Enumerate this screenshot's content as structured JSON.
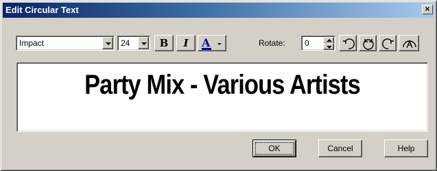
{
  "window": {
    "title": "Edit Circular Text",
    "close_glyph": "×"
  },
  "toolbar": {
    "font_name": "Impact",
    "font_size": "24",
    "bold_label": "B",
    "italic_label": "I",
    "color_label": "A",
    "rotate_label": "Rotate:",
    "rotate_value": "0"
  },
  "icons": {
    "font_dropdown": "chevron-down-icon",
    "size_dropdown": "chevron-down-icon",
    "rotate_ccw": "rotate-counterclockwise-icon",
    "rotate_both": "rotate-both-icon",
    "rotate_cw": "rotate-clockwise-icon",
    "text_on_arc": "text-on-arc-icon"
  },
  "preview": {
    "text": "Party Mix - Various Artists"
  },
  "buttons": {
    "ok": "OK",
    "cancel": "Cancel",
    "help": "Help"
  },
  "colors": {
    "title_gradient_start": "#0a246a",
    "title_gradient_end": "#a6caf0",
    "face": "#d4d0c8",
    "text_color_swatch": "#0000a0"
  }
}
